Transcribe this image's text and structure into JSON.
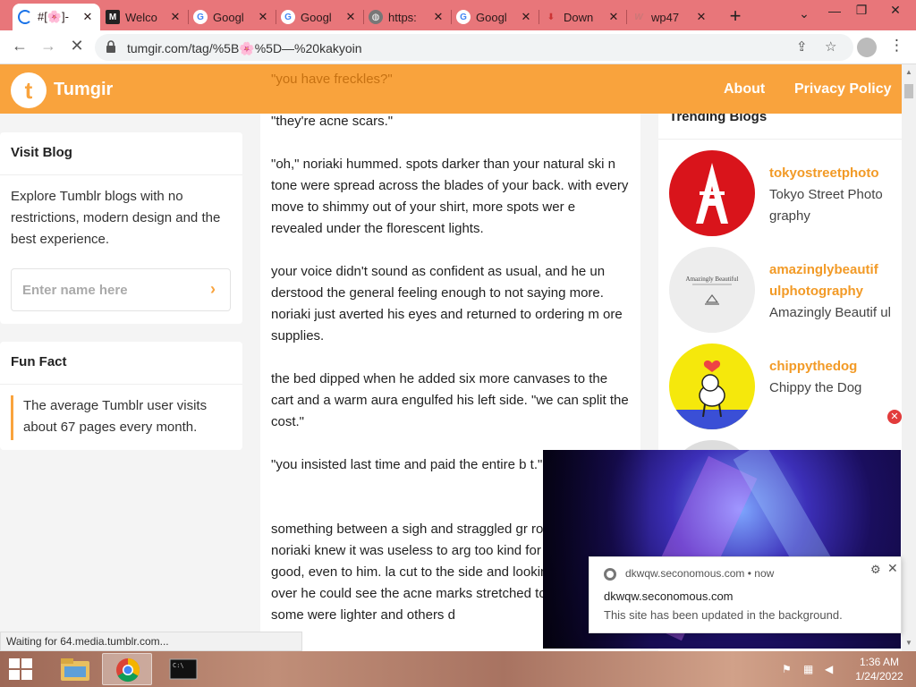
{
  "browser": {
    "tabs": [
      {
        "title": "#[🌸]-",
        "active": true
      },
      {
        "title": "Welco",
        "active": false
      },
      {
        "title": "Googl",
        "active": false
      },
      {
        "title": "Googl",
        "active": false
      },
      {
        "title": "https:",
        "active": false
      },
      {
        "title": "Googl",
        "active": false
      },
      {
        "title": "Down",
        "active": false
      },
      {
        "title": "wp47",
        "active": false
      }
    ],
    "url": "tumgir.com/tag/%5B🌸%5D—%20kakyoin",
    "status": "Waiting for 64.media.tumblr.com..."
  },
  "site": {
    "logo_letter": "t",
    "name": "Tumgir",
    "nav": [
      "About",
      "Privacy Policy"
    ],
    "header_quote": "\"you have freckles?\""
  },
  "sidebar": {
    "visit_blog": {
      "title": "Visit Blog",
      "description": "Explore Tumblr blogs with no restrictions, modern design and the best experience.",
      "input_placeholder": "Enter name here"
    },
    "fun_fact": {
      "title": "Fun Fact",
      "text": "The average Tumblr user visits about 67 pages every month."
    }
  },
  "post": {
    "paragraphs": [
      "\"they're acne scars.\"",
      "\"oh,\" noriaki hummed. spots darker than your natural ski n tone were spread across the blades of your back. with every move to shimmy out of your shirt, more spots wer e revealed under the florescent lights.",
      "your voice didn't sound as confident as usual, and he un derstood the general feeling enough to not saying more. noriaki just averted his eyes and returned to ordering m ore supplies.",
      "the bed dipped when he added six more canvases to the cart and a warm aura engulfed his left side. \"we can split the cost.\"",
      "\"you insisted last time and paid the entire b t.\"",
      "something between a sigh and straggled gr room and noriaki knew it was useless to arg too kind for your own good, even to him. la cut to the side and  looking your body over he could see the acne marks stretched to yo rib cage. some were lighter and others d"
    ]
  },
  "trending": {
    "title": "Trending Blogs",
    "blogs": [
      {
        "handle": "tokyostreetphoto",
        "name": "Tokyo Street Photo graphy"
      },
      {
        "handle": "amazinglybeautif ulphotography",
        "name": "Amazingly Beautif ul",
        "avatar_text": "Amazingly Beautiful"
      },
      {
        "handle": "chippythedog",
        "name": "Chippy the Dog"
      }
    ]
  },
  "notification": {
    "source": "dkwqw.seconomous.com",
    "separator": "•",
    "time": "now",
    "title": "dkwqw.seconomous.com",
    "body": "This site has been updated in the background."
  },
  "taskbar": {
    "time": "1:36 AM",
    "date": "1/24/2022"
  }
}
